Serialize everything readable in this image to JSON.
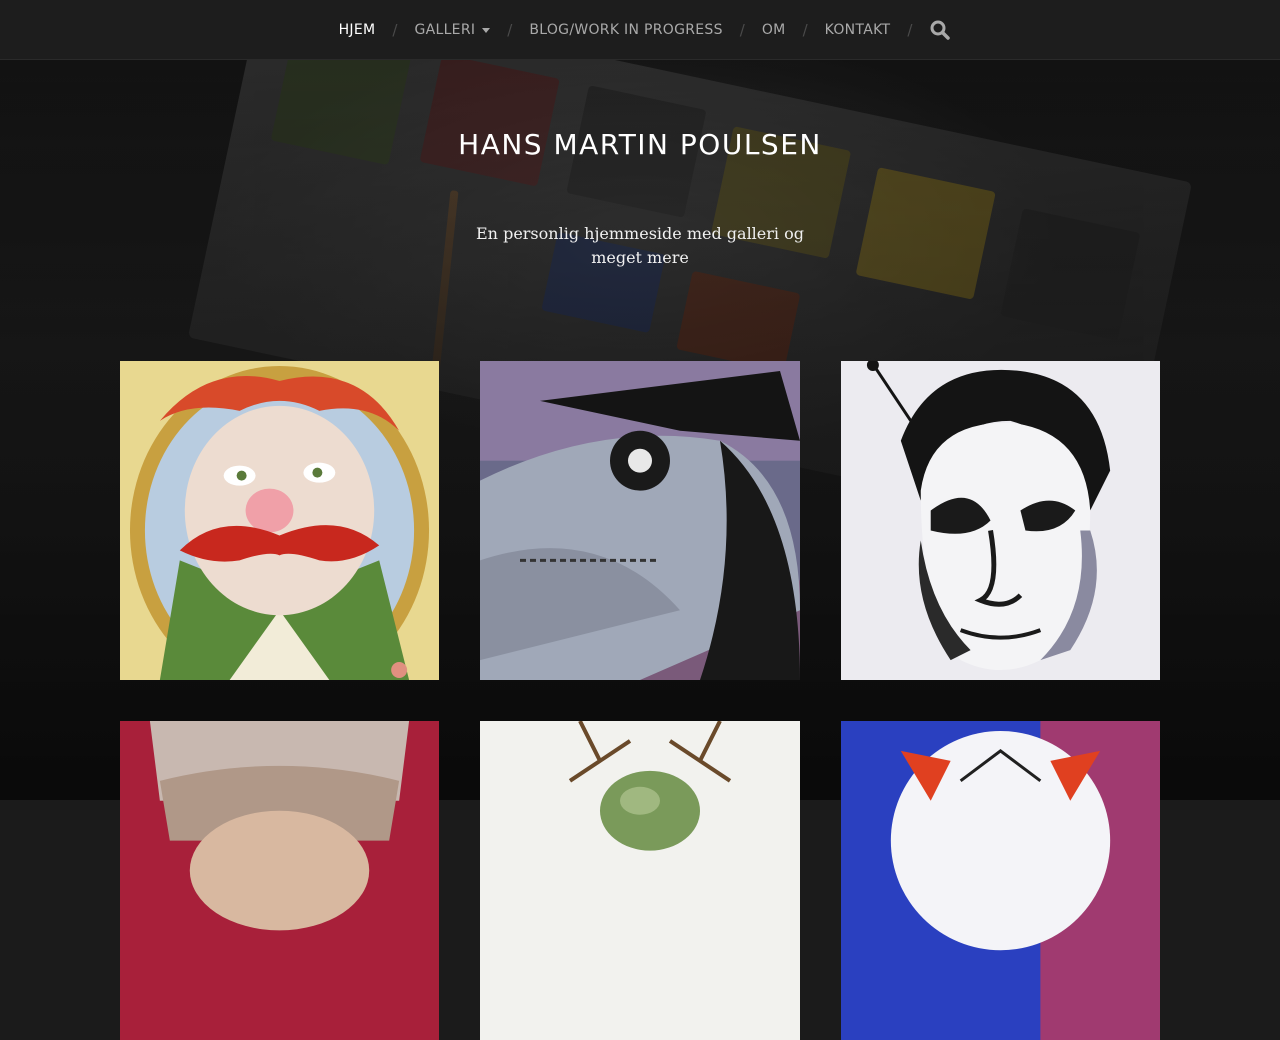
{
  "nav": {
    "items": [
      {
        "label": "HJEM",
        "active": true,
        "dropdown": false
      },
      {
        "label": "GALLERI",
        "active": false,
        "dropdown": true
      },
      {
        "label": "BLOG/WORK IN PROGRESS",
        "active": false,
        "dropdown": false
      },
      {
        "label": "OM",
        "active": false,
        "dropdown": false
      },
      {
        "label": "KONTAKT",
        "active": false,
        "dropdown": false
      }
    ],
    "separator": "/",
    "search_icon": "search-icon"
  },
  "site": {
    "title": "HANS MARTIN POULSEN",
    "description": "En personlig hjemmeside med galleri og meget mere"
  },
  "gallery": {
    "tiles": [
      {
        "name": "portrait-red-mustache",
        "accent": "#c83a24"
      },
      {
        "name": "plague-doctor",
        "accent": "#8a7a9a"
      },
      {
        "name": "ink-portrait-man",
        "accent": "#202020"
      },
      {
        "name": "portrait-hat",
        "accent": "#a02030"
      },
      {
        "name": "antler-creature",
        "accent": "#7a8a5a"
      },
      {
        "name": "blue-white-mask",
        "accent": "#2a40c0"
      }
    ]
  },
  "colors": {
    "nav_bg": "#1d1d1d",
    "nav_text": "#a9a9a9",
    "nav_active": "#ffffff",
    "page_bg": "#1b1b1b"
  }
}
